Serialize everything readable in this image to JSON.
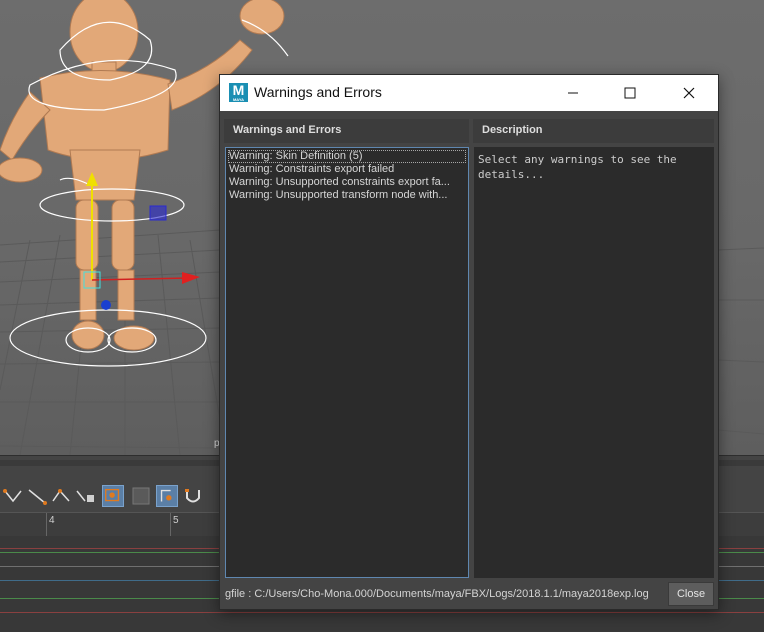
{
  "dialog": {
    "title": "Warnings and Errors",
    "app_icon_letter": "M",
    "app_icon_sub": "MAYA",
    "warnings_header": "Warnings and Errors",
    "description_header": "Description",
    "warnings": [
      "Warning: Skin Definition (5)",
      "Warning: Constraints export failed",
      "Warning: Unsupported constraints export fa...",
      "Warning: Unsupported transform node with..."
    ],
    "description_text": "Select any warnings to see the details...",
    "logfile": "gfile : C:/Users/Cho-Mona.000/Documents/maya/FBX/Logs/2018.1.1/maya2018exp.log",
    "close_label": "Close",
    "window_buttons": [
      "minimize-icon",
      "maximize-icon",
      "close-icon"
    ]
  },
  "background": {
    "viewport_label": "p",
    "timeline_ticks": [
      "4",
      "5"
    ],
    "accent_color": "#5b7fa6"
  }
}
